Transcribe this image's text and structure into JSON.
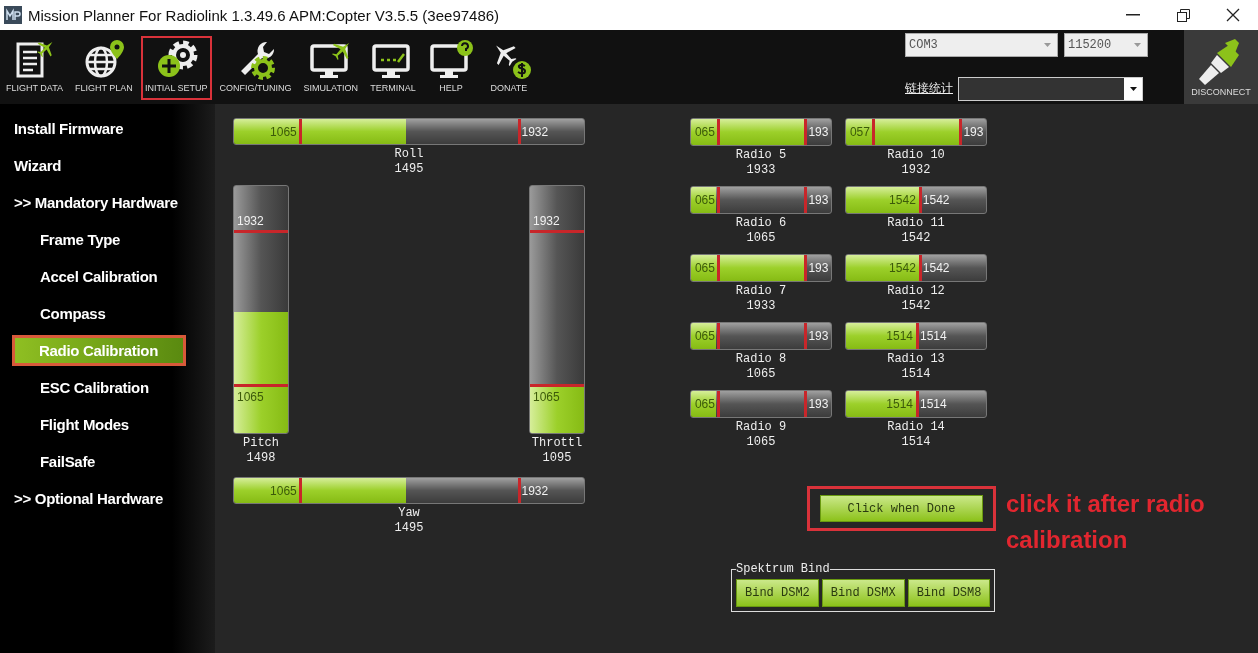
{
  "window": {
    "title": "Mission Planner For Radiolink 1.3.49.6 APM:Copter V3.5.5 (3ee97486)"
  },
  "toolbar": {
    "items": [
      {
        "label": "FLIGHT DATA",
        "selected": false
      },
      {
        "label": "FLIGHT PLAN",
        "selected": false
      },
      {
        "label": "INITIAL SETUP",
        "selected": true
      },
      {
        "label": "CONFIG/TUNING",
        "selected": false
      },
      {
        "label": "SIMULATION",
        "selected": false
      },
      {
        "label": "TERMINAL",
        "selected": false
      },
      {
        "label": "HELP",
        "selected": false
      },
      {
        "label": "DONATE",
        "selected": false
      }
    ],
    "connection": {
      "port": "COM3",
      "baud": "115200",
      "stats_label": "链接统计",
      "button": "DISCONNECT"
    }
  },
  "sidebar": {
    "items": [
      {
        "label": "Install Firmware",
        "selected": false
      },
      {
        "label": "Wizard",
        "selected": false
      },
      {
        "label": ">> Mandatory Hardware",
        "selected": false,
        "children": [
          {
            "label": "Frame Type",
            "selected": false
          },
          {
            "label": "Accel Calibration",
            "selected": false
          },
          {
            "label": "Compass",
            "selected": false
          },
          {
            "label": "Radio Calibration",
            "selected": true
          },
          {
            "label": "ESC Calibration",
            "selected": false
          },
          {
            "label": "Flight Modes",
            "selected": false
          },
          {
            "label": "FailSafe",
            "selected": false
          }
        ]
      },
      {
        "label": ">> Optional Hardware",
        "selected": false
      }
    ]
  },
  "sticks": [
    {
      "name": "Roll",
      "reading": "1495",
      "min": "1065",
      "max": "1932",
      "level": 0.49,
      "kind": "horizontal"
    },
    {
      "name": "Pitch",
      "reading": "1498",
      "min": "1065",
      "max": "1932",
      "level": 0.49,
      "kind": "vertical"
    },
    {
      "name": "Throttl",
      "reading": "1095",
      "min": "1065",
      "max": "1932",
      "level": 0.2,
      "kind": "vertical"
    },
    {
      "name": "Yaw",
      "reading": "1495",
      "min": "1065",
      "max": "1932",
      "level": 0.49,
      "kind": "horizontal"
    }
  ],
  "radios": [
    {
      "name": "Radio 5",
      "reading": "1933",
      "min": "065",
      "max": "193",
      "level": 0.81,
      "kind": "range"
    },
    {
      "name": "Radio 6",
      "reading": "1065",
      "min": "065",
      "max": "193",
      "level": 0.18,
      "kind": "range"
    },
    {
      "name": "Radio 7",
      "reading": "1933",
      "min": "065",
      "max": "193",
      "level": 0.81,
      "kind": "range"
    },
    {
      "name": "Radio 8",
      "reading": "1065",
      "min": "065",
      "max": "193",
      "level": 0.18,
      "kind": "range"
    },
    {
      "name": "Radio 9",
      "reading": "1065",
      "min": "065",
      "max": "193",
      "level": 0.18,
      "kind": "range"
    },
    {
      "name": "Radio 10",
      "reading": "1932",
      "min": "057",
      "max": "193",
      "level": 0.81,
      "kind": "range"
    },
    {
      "name": "Radio 11",
      "reading": "1542",
      "min": "1542",
      "max": "1542",
      "level": 0.52,
      "kind": "center"
    },
    {
      "name": "Radio 12",
      "reading": "1542",
      "min": "1542",
      "max": "1542",
      "level": 0.52,
      "kind": "center"
    },
    {
      "name": "Radio 13",
      "reading": "1514",
      "min": "1514",
      "max": "1514",
      "level": 0.5,
      "kind": "center"
    },
    {
      "name": "Radio 14",
      "reading": "1514",
      "min": "1514",
      "max": "1514",
      "level": 0.5,
      "kind": "center"
    }
  ],
  "done_button": "Click when Done",
  "annotation": "click it after radio calibration",
  "spektrum": {
    "title": "Spektrum Bind",
    "buttons": [
      "Bind DSM2",
      "Bind DSMX",
      "Bind DSM8"
    ]
  }
}
